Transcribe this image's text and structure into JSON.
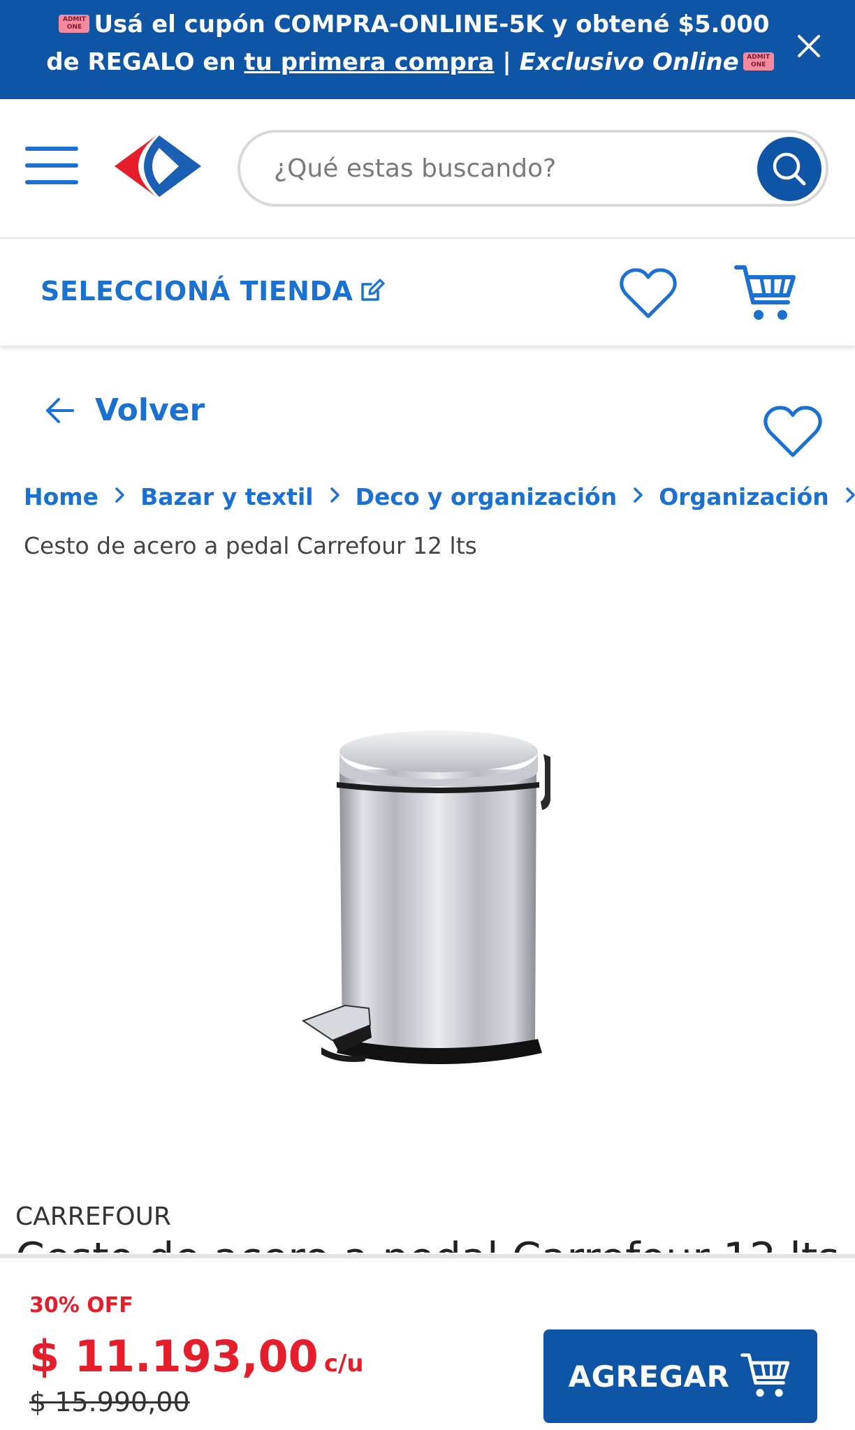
{
  "promo": {
    "text_1": "Usá el cupón COMPRA-ONLINE-5K y obtené $5.000 de REGALO en ",
    "link": "tu primera compra",
    "sep": " | ",
    "italic": "Exclusivo Online",
    "ticket_label": "ADMIT ONE",
    "close_icon": "close-icon"
  },
  "header": {
    "search_placeholder": "¿Qué estas buscando?",
    "menu_icon": "hamburger-menu-icon",
    "search_icon": "search-icon",
    "brand_color": "#0e55a6",
    "accent_color": "#1a71cf",
    "logo_red": "#e41e2b"
  },
  "storebar": {
    "select_store": "SELECCIONÁ TIENDA",
    "edit_icon": "edit-icon",
    "favorites_icon": "heart-icon",
    "cart_icon": "cart-icon"
  },
  "nav": {
    "back": "Volver"
  },
  "breadcrumb": {
    "items": [
      "Home",
      "Bazar y textil",
      "Deco y organización",
      "Organización"
    ],
    "current": "Cesto de acero a pedal Carrefour 12 lts"
  },
  "product": {
    "brand": "CARREFOUR",
    "title_peek": "Cesto de acero a pedal Carrefour 12 lts",
    "image_alt": "stainless-steel-pedal-bin"
  },
  "purchase": {
    "discount": "30% OFF",
    "price": "$ 11.193,00",
    "unit": "c/u",
    "old_price": "$ 15.990,00",
    "add_button": "AGREGAR",
    "price_color": "#e41e2b"
  }
}
